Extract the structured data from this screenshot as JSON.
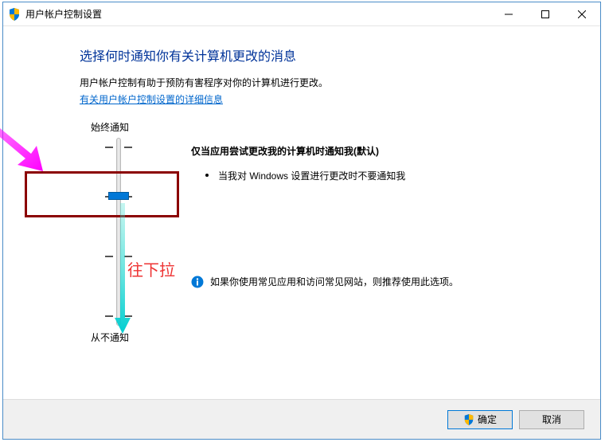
{
  "titlebar": {
    "text": "用户帐户控制设置"
  },
  "heading": "选择何时通知你有关计算机更改的消息",
  "desc": "用户帐户控制有助于预防有害程序对你的计算机进行更改。",
  "link": "有关用户帐户控制设置的详细信息",
  "slider": {
    "top_label": "始终通知",
    "bottom_label": "从不通知"
  },
  "info": {
    "title": "仅当应用尝试更改我的计算机时通知我(默认)",
    "bullet": "当我对 Windows 设置进行更改时不要通知我"
  },
  "recommend": "如果你使用常见应用和访问常见网站，则推荐使用此选项。",
  "annotation": "往下拉",
  "buttons": {
    "ok": "确定",
    "cancel": "取消"
  }
}
